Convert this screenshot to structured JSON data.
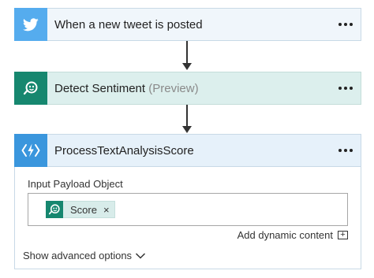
{
  "steps": [
    {
      "title": "When a new tweet is posted",
      "icon": "twitter-bird-icon",
      "accent": "#55acee",
      "background": "#f0f6fb"
    },
    {
      "title": "Detect Sentiment",
      "suffix": "(Preview)",
      "icon": "sentiment-analysis-icon",
      "accent": "#16876f",
      "background": "#dcefed"
    },
    {
      "title": "ProcessTextAnalysisScore",
      "icon": "azure-function-icon",
      "accent": "#3a96dd",
      "background": "#e6f1fa"
    }
  ],
  "action": {
    "field_label": "Input Payload Object",
    "token": {
      "label": "Score",
      "icon": "sentiment-analysis-icon",
      "remove": "×"
    },
    "add_dynamic_content": "Add dynamic content",
    "add_icon": "+",
    "show_advanced_options": "Show advanced options",
    "chevron": "chevron-down-icon"
  }
}
